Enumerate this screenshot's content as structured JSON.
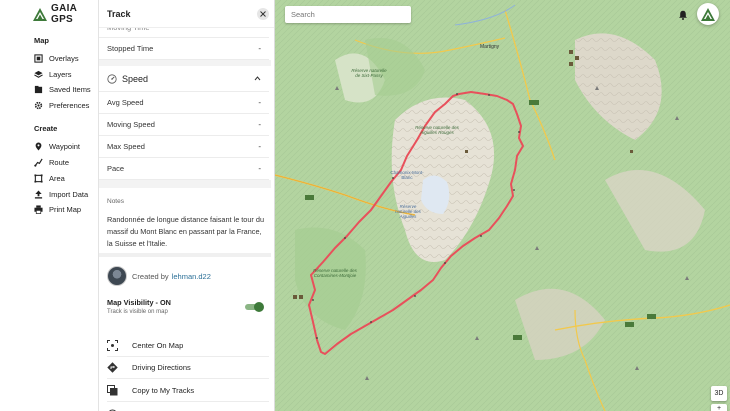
{
  "brand": {
    "name": "GAIA GPS"
  },
  "nav": {
    "map_section": "Map",
    "map_items": [
      {
        "label": "Overlays",
        "icon": "overlays-icon"
      },
      {
        "label": "Layers",
        "icon": "layers-icon"
      },
      {
        "label": "Saved Items",
        "icon": "saved-items-icon"
      },
      {
        "label": "Preferences",
        "icon": "gear-icon"
      }
    ],
    "create_section": "Create",
    "create_items": [
      {
        "label": "Waypoint",
        "icon": "map-pin-icon"
      },
      {
        "label": "Route",
        "icon": "route-icon"
      },
      {
        "label": "Area",
        "icon": "area-icon"
      },
      {
        "label": "Import Data",
        "icon": "upload-icon"
      },
      {
        "label": "Print Map",
        "icon": "printer-icon"
      }
    ]
  },
  "panel": {
    "title": "Track",
    "rows_top": [
      {
        "label": "Moving Time",
        "value": ""
      },
      {
        "label": "Stopped Time",
        "value": "-"
      }
    ],
    "speed_section": "Speed",
    "speed_rows": [
      {
        "label": "Avg Speed",
        "value": "-"
      },
      {
        "label": "Moving Speed",
        "value": "-"
      },
      {
        "label": "Max Speed",
        "value": "-"
      },
      {
        "label": "Pace",
        "value": "-"
      }
    ],
    "notes_label": "Notes",
    "notes_text": "Randonnée de longue distance faisant le tour du massif du Mont Blanc en passant par la France, la Suisse et l'Italie.",
    "created_by_label": "Created by",
    "creator": "lehman.d22",
    "visibility_title": "Map Visibility - ON",
    "visibility_sub": "Track is visible on map",
    "visibility_on": true,
    "actions": [
      {
        "label": "Center On Map",
        "icon": "center-icon"
      },
      {
        "label": "Driving Directions",
        "icon": "directions-icon"
      },
      {
        "label": "Copy to My Tracks",
        "icon": "copy-icon"
      }
    ]
  },
  "map": {
    "search_placeholder": "Search",
    "view_toggle": "3D",
    "zoom_label": "+",
    "labels": {
      "martigny": "Martigny",
      "reserve_sixt": "Réserve naturelle de Sixt-Passy",
      "reserve_aiguilles": "Réserve naturelle des Aiguilles Rouges",
      "chamonix": "Chamonix-Mont-Blanc",
      "reserve_contamines": "Réserve naturelle des Contamines-Montjoie",
      "reserve_aiguilles_short": "Réserve naturelle des Aiguilles"
    },
    "colors": {
      "track": "#e8505b",
      "terrain": "#b7d7a5",
      "brand": "#3e7a3a"
    }
  }
}
